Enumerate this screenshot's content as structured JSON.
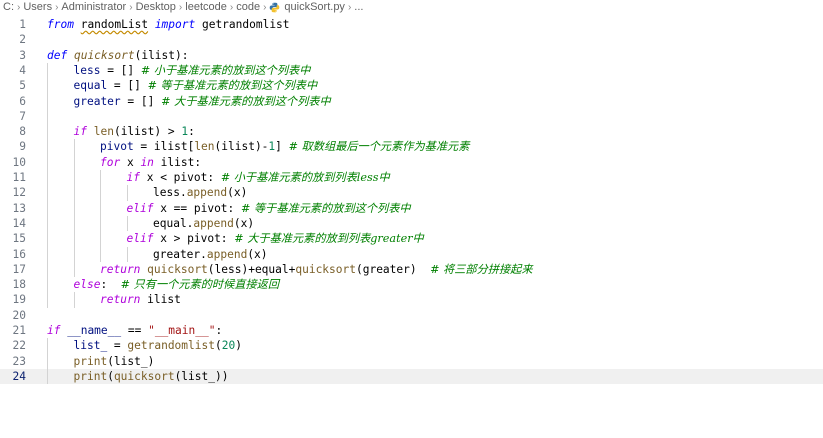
{
  "breadcrumb": {
    "items": [
      "C:",
      "Users",
      "Administrator",
      "Desktop",
      "leetcode",
      "code"
    ],
    "file": "quickSort.py",
    "trail": "..."
  },
  "editor": {
    "current_line": 24,
    "lines": [
      {
        "n": "1",
        "indent": 0,
        "tokens": [
          [
            "kw",
            "from"
          ],
          [
            "p",
            " "
          ],
          [
            "mod",
            "randomList"
          ],
          [
            "p",
            " "
          ],
          [
            "kw",
            "import"
          ],
          [
            "p",
            " getrandomlist"
          ]
        ]
      },
      {
        "n": "2",
        "indent": 0,
        "tokens": []
      },
      {
        "n": "3",
        "indent": 0,
        "tokens": [
          [
            "kw",
            "def"
          ],
          [
            "p",
            " "
          ],
          [
            "fndef",
            "quicksort"
          ],
          [
            "p",
            "(ilist):"
          ]
        ]
      },
      {
        "n": "4",
        "indent": 1,
        "tokens": [
          [
            "var",
            "less"
          ],
          [
            "p",
            " = [] "
          ],
          [
            "cmt",
            "# 小于基准元素的放到这个列表中"
          ]
        ]
      },
      {
        "n": "5",
        "indent": 1,
        "tokens": [
          [
            "var",
            "equal"
          ],
          [
            "p",
            " = [] "
          ],
          [
            "cmt",
            "# 等于基准元素的放到这个列表中"
          ]
        ]
      },
      {
        "n": "6",
        "indent": 1,
        "tokens": [
          [
            "var",
            "greater"
          ],
          [
            "p",
            " = [] "
          ],
          [
            "cmt",
            "# 大于基准元素的放到这个列表中"
          ]
        ]
      },
      {
        "n": "7",
        "indent": 0,
        "tokens": []
      },
      {
        "n": "8",
        "indent": 1,
        "tokens": [
          [
            "ctl",
            "if"
          ],
          [
            "p",
            " "
          ],
          [
            "fn",
            "len"
          ],
          [
            "p",
            "(ilist) > "
          ],
          [
            "num",
            "1"
          ],
          [
            "p",
            ":"
          ]
        ]
      },
      {
        "n": "9",
        "indent": 2,
        "tokens": [
          [
            "var",
            "pivot"
          ],
          [
            "p",
            " = ilist["
          ],
          [
            "fn",
            "len"
          ],
          [
            "p",
            "(ilist)-"
          ],
          [
            "num",
            "1"
          ],
          [
            "p",
            "] "
          ],
          [
            "cmt",
            "# 取数组最后一个元素作为基准元素"
          ]
        ]
      },
      {
        "n": "10",
        "indent": 2,
        "tokens": [
          [
            "ctl",
            "for"
          ],
          [
            "p",
            " x "
          ],
          [
            "ctl",
            "in"
          ],
          [
            "p",
            " ilist:"
          ]
        ]
      },
      {
        "n": "11",
        "indent": 3,
        "tokens": [
          [
            "ctl",
            "if"
          ],
          [
            "p",
            " x < pivot: "
          ],
          [
            "cmt",
            "# 小于基准元素的放到列表less中"
          ]
        ]
      },
      {
        "n": "12",
        "indent": 4,
        "tokens": [
          [
            "p",
            "less."
          ],
          [
            "fn",
            "append"
          ],
          [
            "p",
            "(x)"
          ]
        ]
      },
      {
        "n": "13",
        "indent": 3,
        "tokens": [
          [
            "ctl",
            "elif"
          ],
          [
            "p",
            " x == pivot: "
          ],
          [
            "cmt",
            "# 等于基准元素的放到这个列表中"
          ]
        ]
      },
      {
        "n": "14",
        "indent": 4,
        "tokens": [
          [
            "p",
            "equal."
          ],
          [
            "fn",
            "append"
          ],
          [
            "p",
            "(x)"
          ]
        ]
      },
      {
        "n": "15",
        "indent": 3,
        "tokens": [
          [
            "ctl",
            "elif"
          ],
          [
            "p",
            " x > pivot: "
          ],
          [
            "cmt",
            "# 大于基准元素的放到列表greater中"
          ]
        ]
      },
      {
        "n": "16",
        "indent": 4,
        "tokens": [
          [
            "p",
            "greater."
          ],
          [
            "fn",
            "append"
          ],
          [
            "p",
            "(x)"
          ]
        ]
      },
      {
        "n": "17",
        "indent": 2,
        "tokens": [
          [
            "ctl",
            "return"
          ],
          [
            "p",
            " "
          ],
          [
            "fn",
            "quicksort"
          ],
          [
            "p",
            "(less)+equal+"
          ],
          [
            "fn",
            "quicksort"
          ],
          [
            "p",
            "(greater)  "
          ],
          [
            "cmt",
            "# 将三部分拼接起来"
          ]
        ]
      },
      {
        "n": "18",
        "indent": 1,
        "tokens": [
          [
            "ctl",
            "else"
          ],
          [
            "p",
            ":  "
          ],
          [
            "cmt",
            "# 只有一个元素的时候直接返回"
          ]
        ]
      },
      {
        "n": "19",
        "indent": 2,
        "tokens": [
          [
            "ctl",
            "return"
          ],
          [
            "p",
            " ilist"
          ]
        ]
      },
      {
        "n": "20",
        "indent": 0,
        "tokens": []
      },
      {
        "n": "21",
        "indent": 0,
        "tokens": [
          [
            "ctl",
            "if"
          ],
          [
            "p",
            " "
          ],
          [
            "var",
            "__name__"
          ],
          [
            "p",
            " == "
          ],
          [
            "str",
            "\"__main__\""
          ],
          [
            "p",
            ":"
          ]
        ]
      },
      {
        "n": "22",
        "indent": 1,
        "tokens": [
          [
            "var",
            "list_"
          ],
          [
            "p",
            " = "
          ],
          [
            "fn",
            "getrandomlist"
          ],
          [
            "p",
            "("
          ],
          [
            "num",
            "20"
          ],
          [
            "p",
            ")"
          ]
        ]
      },
      {
        "n": "23",
        "indent": 1,
        "tokens": [
          [
            "fn",
            "print"
          ],
          [
            "p",
            "(list_)"
          ]
        ]
      },
      {
        "n": "24",
        "indent": 1,
        "tokens": [
          [
            "fn",
            "print"
          ],
          [
            "p",
            "("
          ],
          [
            "fn",
            "quicksort"
          ],
          [
            "p",
            "(list_))"
          ]
        ]
      }
    ]
  }
}
